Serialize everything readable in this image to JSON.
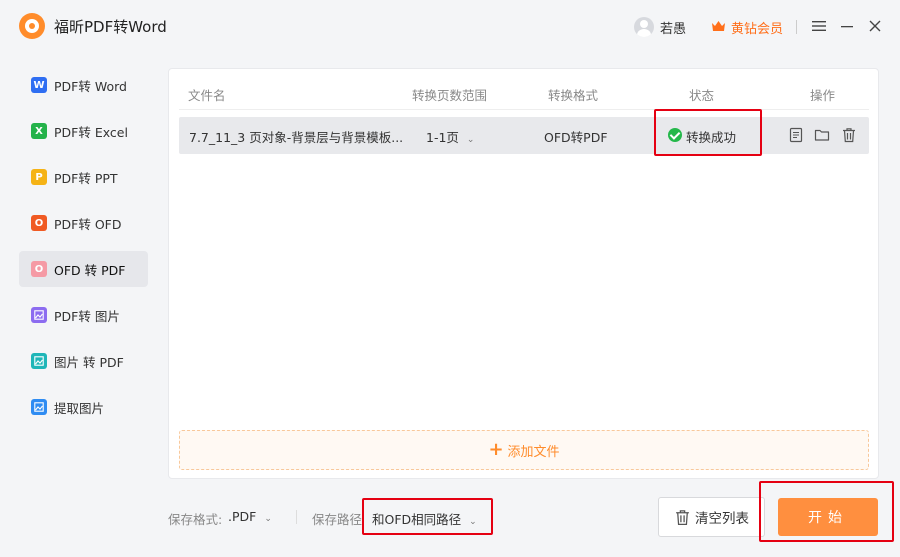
{
  "app": {
    "title": "福昕PDF转Word"
  },
  "user": {
    "name": "若愚",
    "vip_label": "黄钻会员"
  },
  "window": {
    "menu": "menu",
    "minimize": "minimize",
    "close": "close"
  },
  "sidebar": {
    "items": [
      {
        "label": "PDF转 Word",
        "icon": "W",
        "color": "#2f6ef2"
      },
      {
        "label": "PDF转 Excel",
        "icon": "X",
        "color": "#24b24a"
      },
      {
        "label": "PDF转 PPT",
        "icon": "P",
        "color": "#f5b316"
      },
      {
        "label": "PDF转 OFD",
        "icon": "O",
        "color": "#f05a23"
      },
      {
        "label": "OFD 转 PDF",
        "icon": "O",
        "color": "#f59aa5",
        "active": true
      },
      {
        "label": "PDF转 图片",
        "icon": "",
        "color": "#8c6cf0"
      },
      {
        "label": "图片 转 PDF",
        "icon": "",
        "color": "#1fb6b8"
      },
      {
        "label": "提取图片",
        "icon": "",
        "color": "#2f8cf2"
      }
    ]
  },
  "table": {
    "headers": {
      "filename": "文件名",
      "range": "转换页数范围",
      "format": "转换格式",
      "status": "状态",
      "ops": "操作"
    },
    "rows": [
      {
        "filename": "7.7_11_3 页对象-背景层与背景模板...",
        "range": "1-1页",
        "format": "OFD转PDF",
        "status": "转换成功"
      }
    ]
  },
  "add_file": {
    "label": "添加文件"
  },
  "bottom": {
    "format_label": "保存格式:",
    "format_value": ".PDF",
    "path_label": "保存路径",
    "path_value": "和OFD相同路径",
    "clear_label": "清空列表",
    "start_label": "开始"
  },
  "colors": {
    "accent": "#ff8c2b",
    "highlight": "#e50012",
    "success": "#25b84b"
  }
}
